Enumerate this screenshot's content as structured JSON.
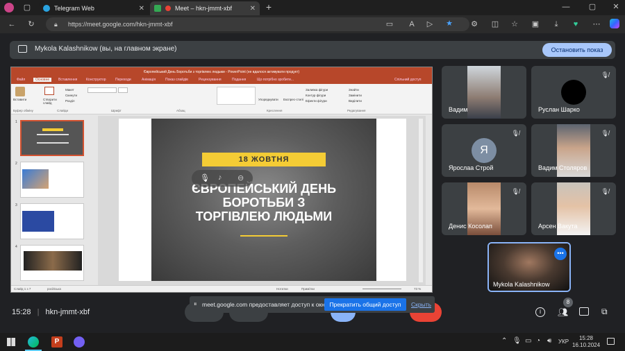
{
  "browser": {
    "tabs": [
      {
        "title": "Telegram Web",
        "active": false
      },
      {
        "title": "Meet – hkn-jmmt-xbf",
        "active": true
      }
    ],
    "url": "https://meet.google.com/hkn-jmmt-xbf"
  },
  "banner": {
    "text": "Mykola Kalashnikow (вы, на главном экране)",
    "stop_label": "Остановить показ"
  },
  "powerpoint": {
    "title": "Європейський День Боротьби з торгівлею людьми - PowerPoint (не вдалося активувати продукт)",
    "menu": [
      "Файл",
      "Основне",
      "Вставлення",
      "Конструктор",
      "Переходи",
      "Анімація",
      "Показ слайдів",
      "Рецензування",
      "Подання",
      "Що потрібно зробити...",
      "Спільний доступ"
    ],
    "groups": [
      "Буфер обміну",
      "Слайди",
      "Шрифт",
      "Абзац",
      "Креслення",
      "Редагування"
    ],
    "ribbon_items": [
      "Вставити",
      "Створити слайд",
      "Макет",
      "Скинути",
      "Розділ",
      "Упорядкувати",
      "Експрес-стилі",
      "Заливка фігури",
      "Контур фігури",
      "Ефекти фігури",
      "Знайти",
      "Замінити",
      "Виділити"
    ],
    "status": {
      "slide": "Слайд 1 з 7",
      "lang": "російська",
      "notes": "Нотатки",
      "comments": "Примітки",
      "zoom": "73 %"
    },
    "thumb_numbers": [
      "1",
      "2",
      "3",
      "4"
    ],
    "slide": {
      "date": "18 ЖОВТНЯ",
      "title_lines": [
        "ЄВРОПЕЙСЬКИЙ ДЕНЬ",
        "БОРОТЬБИ З",
        "ТОРГІВЛЕЮ ЛЮДЬМИ"
      ]
    }
  },
  "participants": [
    {
      "name": "Вадим",
      "muted": false,
      "type": "video"
    },
    {
      "name": "Руслан Шарко",
      "muted": true,
      "type": "avatar-dark"
    },
    {
      "name": "Ярослаа Строй",
      "muted": true,
      "type": "letter",
      "letter": "Я"
    },
    {
      "name": "Вадим Столяров",
      "muted": true,
      "type": "video"
    },
    {
      "name": "Денис Косолап",
      "muted": true,
      "type": "video"
    },
    {
      "name": "Арсен Вакута",
      "muted": true,
      "type": "video"
    },
    {
      "name": "Mykola Kalashnikow",
      "muted": false,
      "type": "self"
    }
  ],
  "bottom": {
    "time": "15:28",
    "code": "hkn-jmmt-xbf",
    "share_text": "meet.google.com предоставляет доступ к окну.",
    "stop_share": "Прекратить общий доступ",
    "hide": "Скрыть",
    "people_count": "8"
  },
  "taskbar": {
    "lang": "УКР",
    "time": "15:28",
    "date": "16.10.2024"
  },
  "colors": {
    "meet_bg": "#202124",
    "accent": "#a8c7fa",
    "ppt_red": "#b7472a",
    "slide_yellow": "#f4cc35"
  }
}
